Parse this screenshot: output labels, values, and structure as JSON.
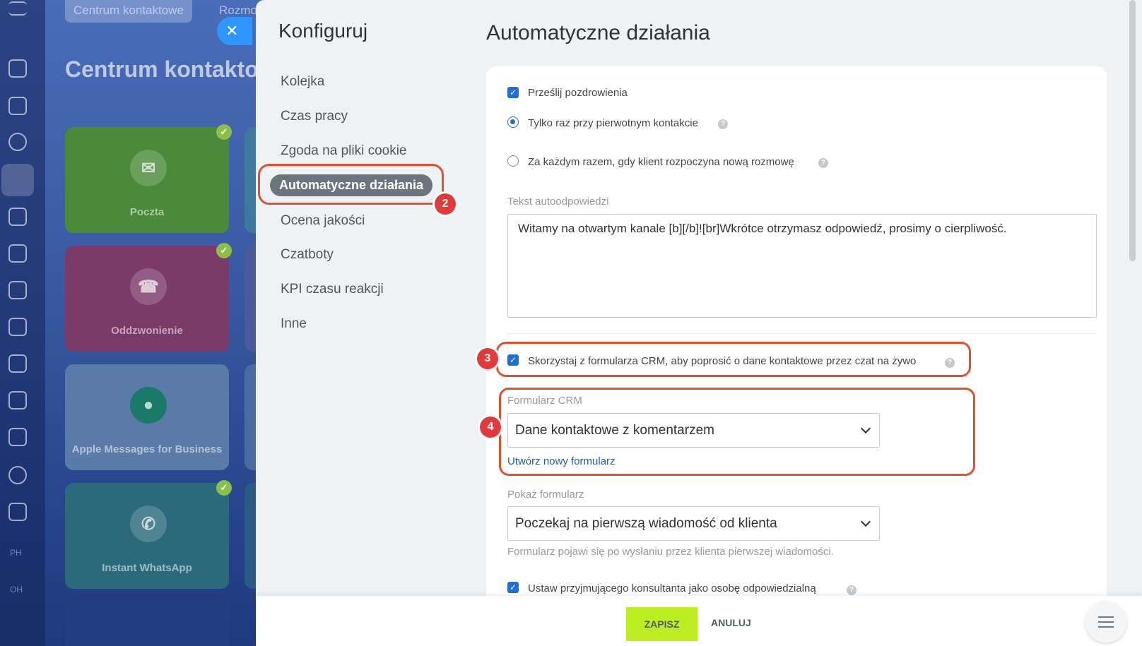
{
  "background": {
    "tabs": [
      "Centrum kontaktowe",
      "Rozmo"
    ],
    "title": "Centrum kontaktow",
    "tiles": [
      {
        "label": "Poczta",
        "icon": "envelope-icon",
        "color": "#4a8a3a",
        "connected": true
      },
      {
        "label": "Oddzwonienie",
        "icon": "phone-icon",
        "color": "#7a3a6a",
        "connected": true
      },
      {
        "label": "Apple Messages for Business",
        "icon": "chat-bubble-icon",
        "color": "#5a7aa8",
        "connected": false
      },
      {
        "label": "Instant WhatsApp",
        "icon": "whatsapp-icon",
        "color": "#2a6a7a",
        "connected": true
      }
    ],
    "sidebar_text": [
      "PH",
      "OH"
    ]
  },
  "nav": {
    "title": "Konfiguruj",
    "items": [
      "Kolejka",
      "Czas pracy",
      "Zgoda na pliki cookie",
      "Automatyczne działania",
      "Ocena jakości",
      "Czatboty",
      "KPI czasu reakcji",
      "Inne"
    ],
    "active_index": 3
  },
  "main": {
    "title": "Automatyczne działania",
    "greet_checkbox": {
      "label": "Prześlij pozdrowienia",
      "checked": true
    },
    "radio_once": {
      "label": "Tylko raz przy pierwotnym kontakcie",
      "selected": true
    },
    "radio_each": {
      "label": "Za każdym razem, gdy klient rozpoczyna nową rozmowę",
      "selected": false
    },
    "autoreply_label": "Tekst autoodpowiedzi",
    "autoreply_text": "Witamy na otwartym kanale [b][/b]![br]Wkrótce otrzymasz odpowiedź, prosimy o cierpliwość.",
    "crm_checkbox": {
      "label": "Skorzystaj z formularza CRM, aby poprosić o dane kontaktowe przez czat na żywo",
      "checked": true
    },
    "crm_form_label": "Formularz CRM",
    "crm_form_value": "Dane kontaktowe z komentarzem",
    "create_form_link": "Utwórz nowy formularz",
    "show_form_label": "Pokaż formularz",
    "show_form_value": "Poczekaj na pierwszą wiadomość od klienta",
    "show_form_hint": "Formularz pojawi się po wysłaniu przez klienta pierwszej wiadomości.",
    "responsible_checkbox": {
      "label": "Ustaw przyjmującego konsultanta jako osobę odpowiedzialną",
      "checked": true
    }
  },
  "annotations": [
    "2",
    "3",
    "4"
  ],
  "footer": {
    "save": "ZAPISZ",
    "cancel": "ANULUJ"
  },
  "colors": {
    "accent": "#1f6fd6",
    "annotation": "#e0512e",
    "save": "#bbed21"
  }
}
